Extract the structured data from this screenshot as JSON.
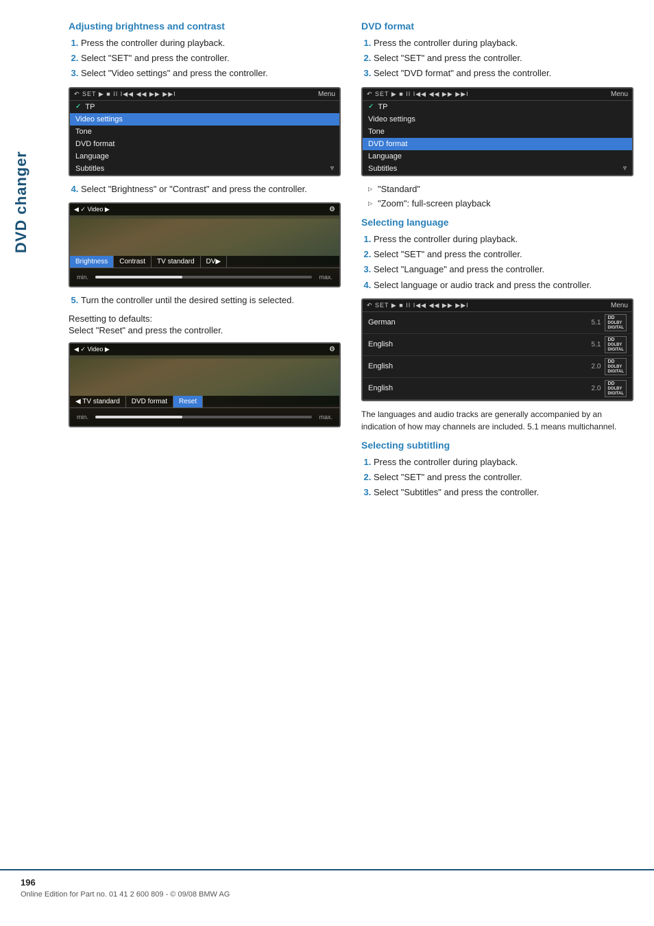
{
  "sidebar": {
    "label": "DVD changer"
  },
  "left_column": {
    "title": "Adjusting brightness and contrast",
    "steps": [
      "Press the controller during playback.",
      "Select \"SET\" and press the controller.",
      "Select \"Video settings\" and press the controller."
    ],
    "screen1": {
      "toolbar": "SET ▶ ■ II I◀◀ ◀◀ ▶▶ ▶▶I Menu",
      "rows": [
        {
          "label": "ꙅV TP",
          "selected": false,
          "check": true
        },
        {
          "label": "Video settings",
          "selected": true
        },
        {
          "label": "Tone",
          "selected": false
        },
        {
          "label": "DVD format",
          "selected": false
        },
        {
          "label": "Language",
          "selected": false
        },
        {
          "label": "Subtitles",
          "selected": false
        }
      ]
    },
    "step4": "Select \"Brightness\" or \"Contrast\" and press the controller.",
    "screen2": {
      "toolbar": "◀ ✓ Video ▶",
      "tabs": [
        "Brightness",
        "Contrast",
        "TV standard",
        "DV▶"
      ],
      "active_tab": "Brightness",
      "slider_min": "min.",
      "slider_max": "max."
    },
    "step5": "Turn the controller until the desired setting is selected.",
    "resetting_label": "Resetting to defaults:",
    "reset_instruction": "Select \"Reset\" and press the controller.",
    "screen3": {
      "toolbar": "◀ ✓ Video ▶",
      "tabs": [
        "◄ TV standard",
        "DVD format",
        "Reset"
      ],
      "active_tab": "Reset",
      "slider_min": "min.",
      "slider_max": "max."
    }
  },
  "right_column": {
    "dvd_format": {
      "title": "DVD format",
      "steps": [
        "Press the controller during playback.",
        "Select \"SET\" and press the controller.",
        "Select \"DVD format\" and press the controller."
      ],
      "screen": {
        "toolbar": "SET ▶ ■ II I◀◀ ◀◀ ▶▶ ▶▶I Menu",
        "rows": [
          {
            "label": "ꙅV TP",
            "check": true
          },
          {
            "label": "Video settings"
          },
          {
            "label": "Tone"
          },
          {
            "label": "DVD format",
            "selected": true
          },
          {
            "label": "Language"
          },
          {
            "label": "Subtitles"
          }
        ]
      },
      "bullets": [
        "\"Standard\"",
        "\"Zoom\": full-screen playback"
      ]
    },
    "selecting_language": {
      "title": "Selecting language",
      "steps": [
        "Press the controller during playback.",
        "Select \"SET\" and press the controller.",
        "Select \"Language\" and press the controller.",
        "Select language or audio track and press the controller."
      ],
      "screen": {
        "toolbar": "SET ▶ ■ II I◀◀ ◀◀ ▶▶ ▶▶I Menu",
        "rows": [
          {
            "lang": "German",
            "ch": "5.1",
            "dolby": "DD DOLBY DIGITAL"
          },
          {
            "lang": "English",
            "ch": "5.1",
            "dolby": "DD DOLBY DIGITAL"
          },
          {
            "lang": "English",
            "ch": "2.0",
            "dolby": "DD DOLBY DIGITAL"
          },
          {
            "lang": "English",
            "ch": "2.0",
            "dolby": "DD DOLBY DIGITAL"
          }
        ]
      },
      "note": "The languages and audio tracks are generally accompanied by an indication of how may channels are included. 5.1 means multichannel."
    },
    "selecting_subtitling": {
      "title": "Selecting subtitling",
      "steps": [
        "Press the controller during playback.",
        "Select \"SET\" and press the controller.",
        "Select \"Subtitles\" and press the controller."
      ]
    }
  },
  "footer": {
    "page_number": "196",
    "copyright": "Online Edition for Part no. 01 41 2 600 809 - © 09/08 BMW AG"
  }
}
